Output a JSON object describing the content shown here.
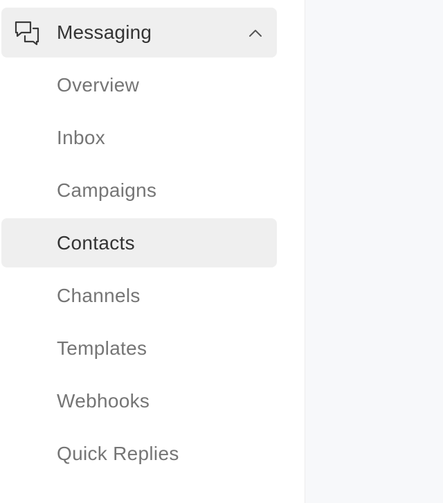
{
  "sidebar": {
    "section": {
      "title": "Messaging",
      "icon": "chat-bubbles-icon",
      "toggle_icon": "chevron-up-icon",
      "expanded": true
    },
    "items": [
      {
        "label": "Overview",
        "active": false
      },
      {
        "label": "Inbox",
        "active": false
      },
      {
        "label": "Campaigns",
        "active": false
      },
      {
        "label": "Contacts",
        "active": true
      },
      {
        "label": "Channels",
        "active": false
      },
      {
        "label": "Templates",
        "active": false
      },
      {
        "label": "Webhooks",
        "active": false
      },
      {
        "label": "Quick Replies",
        "active": false
      }
    ]
  },
  "colors": {
    "active_background": "#efefef",
    "active_text": "#333333",
    "inactive_text": "#757575",
    "main_background": "#f7f8fa"
  }
}
